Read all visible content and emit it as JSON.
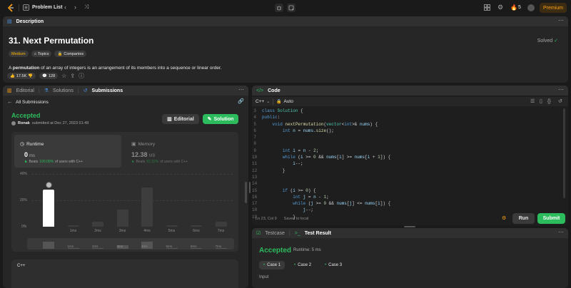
{
  "topbar": {
    "problem_list": "Problem List",
    "streak": "5",
    "premium": "Premium"
  },
  "description": {
    "tab_label": "Description",
    "title": "31. Next Permutation",
    "solved": "Solved",
    "difficulty": "Medium",
    "topics": "Topics",
    "companies": "Companies",
    "text_bold": "permutation",
    "text_pre": "A ",
    "text_rest": " of an array of integers is an arrangement of its members into a sequence or linear order.",
    "likes": "17.5K",
    "comments": "128"
  },
  "left_tabs": {
    "editorial": "Editorial",
    "solutions": "Solutions",
    "submissions": "Submissions"
  },
  "submission": {
    "back": "All Submissions",
    "status": "Accepted",
    "user": "Ronak",
    "submitted": "submitted at Dec 27, 2023 01:49",
    "editorial_btn": "Editorial",
    "solution_btn": "Solution",
    "runtime_label": "Runtime",
    "runtime_value": "0",
    "runtime_unit": "ms",
    "beats_label": "Beats",
    "runtime_beats": "100.00%",
    "runtime_beats_rest": "of users with C++",
    "memory_label": "Memory",
    "memory_value": "12.38",
    "memory_unit": "MB",
    "memory_beats": "62.32%",
    "memory_beats_rest": "of users with C++",
    "lang": "C++"
  },
  "chart_data": {
    "type": "bar",
    "y_ticks": [
      "40%",
      "20%",
      "0%"
    ],
    "ylim": [
      0,
      40
    ],
    "categories": [
      "0ms",
      "1ms",
      "2ms",
      "3ms",
      "4ms",
      "5ms",
      "6ms",
      "7ms"
    ],
    "x_tick_labels": [
      "1ms",
      "2ms",
      "3ms",
      "4ms",
      "5ms",
      "6ms",
      "7ms"
    ],
    "values": [
      28,
      1,
      4,
      13,
      30,
      1,
      1,
      4
    ],
    "active_index": 0
  },
  "code": {
    "tab_label": "Code",
    "lang": "C++",
    "mode": "Auto",
    "status": "Ln 23, Col 9",
    "saved": "Saved to local",
    "run": "Run",
    "submit": "Submit",
    "lines": [
      {
        "n": "3",
        "t": "class Solution {"
      },
      {
        "n": "4",
        "t": "public:"
      },
      {
        "n": "5",
        "t": "    void nextPermutation(vector<int>& nums) {"
      },
      {
        "n": "6",
        "t": "        int n = nums.size();"
      },
      {
        "n": "7",
        "t": ""
      },
      {
        "n": "8",
        "t": ""
      },
      {
        "n": "9",
        "t": "        int i = n - 2;"
      },
      {
        "n": "10",
        "t": "        while (i >= 0 && nums[i] >= nums[i + 1]) {"
      },
      {
        "n": "11",
        "t": "            i--;"
      },
      {
        "n": "12",
        "t": "        }"
      },
      {
        "n": "13",
        "t": ""
      },
      {
        "n": "14",
        "t": ""
      },
      {
        "n": "15",
        "t": "        if (i >= 0) {"
      },
      {
        "n": "16",
        "t": "            int j = n - 1;"
      },
      {
        "n": "17",
        "t": "            while (j >= 0 && nums[j] <= nums[i]) {"
      },
      {
        "n": "18",
        "t": "                j--;"
      },
      {
        "n": "19",
        "t": "            }"
      }
    ]
  },
  "testpanel": {
    "testcase_tab": "Testcase",
    "result_tab": "Test Result",
    "status": "Accepted",
    "runtime": "Runtime: 5 ms",
    "cases": [
      "Case 1",
      "Case 2",
      "Case 3"
    ],
    "input_label": "Input"
  },
  "colors": {
    "accepted": "#2cbb5d",
    "premium_text": "#ffa116",
    "difficulty": "#ffb800"
  }
}
